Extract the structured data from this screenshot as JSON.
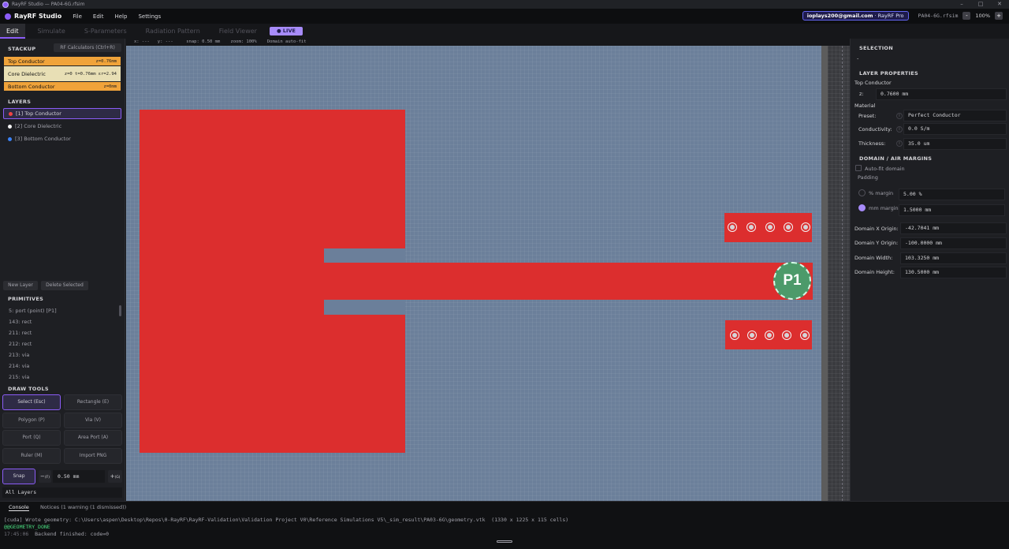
{
  "os": {
    "title": "RayRF Studio — PA04-6G.rfsim",
    "controls": [
      "–",
      "□",
      "✕"
    ]
  },
  "menubar": {
    "logo": "RayRF Studio",
    "menus": [
      "File",
      "Edit",
      "Help",
      "Settings"
    ],
    "account_email": "ioplays200@gmail.com",
    "account_plan": " · RayRF Pro",
    "file_name": "PA04-6G.rfsim",
    "zoom_out": "-",
    "zoom_value": "100%",
    "zoom_in": "+"
  },
  "tabs": [
    {
      "label": "Edit",
      "active": true
    },
    {
      "label": "Simulate",
      "active": false
    },
    {
      "label": "S-Parameters",
      "active": false
    },
    {
      "label": "Radiation Pattern",
      "active": false
    },
    {
      "label": "Field Viewer",
      "active": false
    }
  ],
  "live_badge": "● LIVE",
  "left": {
    "stackup_title": "STACKUP",
    "rf_calc_button": "RF Calculators (Ctrl+R)",
    "stack": [
      {
        "name": "Top Conductor",
        "meta": "z=0.76mm",
        "color": "#f0a33a"
      },
      {
        "name": "Core Dielectric",
        "meta": "z=0   t=0.76mm   εr=2.94",
        "color": "#e8dfb5"
      },
      {
        "name": "Bottom Conductor",
        "meta": "z=0mm",
        "color": "#f0a33a"
      }
    ],
    "layers_title": "LAYERS",
    "layers": [
      {
        "label": "[1] Top Conductor",
        "dot": "#ef4444",
        "selected": true
      },
      {
        "label": "[2] Core Dielectric",
        "dot": "#f4f4f5",
        "selected": false
      },
      {
        "label": "[3] Bottom Conductor",
        "dot": "#3b82f6",
        "selected": false
      }
    ],
    "new_layer": "New Layer",
    "delete_selected": "Delete Selected",
    "primitives_title": "PRIMITIVES",
    "primitives": [
      "5: port (point) [P1]",
      "143: rect",
      "211: rect",
      "212: rect",
      "213: via",
      "214: via",
      "215: via"
    ],
    "draw_tools_title": "DRAW TOOLS",
    "tools": [
      "Select (Esc)",
      "Rectangle (E)",
      "Polygon (P)",
      "Via (V)",
      "Port (Q)",
      "Area Port (A)",
      "Ruler (M)",
      "Import PNG"
    ],
    "snap_button": "Snap",
    "snap_minus": "−",
    "snap_minus_key": "(F)",
    "snap_value": "0.50 mm",
    "snap_plus": "+",
    "snap_plus_key": "(G)",
    "layer_filter": "All Layers"
  },
  "canvas": {
    "readout": "x: ---   y: ---     snap: 0.50 mm    zoom: 100%    Domain auto-fit",
    "port_label": "P1",
    "domain_color": "#6b7f9a",
    "conductor_color": "#dc2e2e"
  },
  "right": {
    "selection_title": "SELECTION",
    "selection_value": "-",
    "layer_props_title": "LAYER PROPERTIES",
    "layer_name": "Top Conductor",
    "z_label": "z:",
    "z_value": "0.7600 mm",
    "material_title": "Material",
    "preset_label": "Preset:",
    "preset_value": "Perfect Conductor",
    "conductivity_label": "Conductivity:",
    "conductivity_value": "0.0 S/m",
    "thickness_label": "Thickness:",
    "thickness_value": "35.0 um",
    "domain_title": "DOMAIN / AIR MARGINS",
    "autofit_label": "Auto-fit domain",
    "padding_label": "Padding",
    "pct_margin_label": "% margin",
    "pct_margin_value": "5.00 %",
    "mm_margin_label": "mm margin",
    "mm_margin_value": "1.5000 mm",
    "dom_x_label": "Domain X Origin:",
    "dom_x_value": "-42.7041 mm",
    "dom_y_label": "Domain Y Origin:",
    "dom_y_value": "-100.0000 mm",
    "dom_w_label": "Domain Width:",
    "dom_w_value": "103.3250 mm",
    "dom_h_label": "Domain Height:",
    "dom_h_value": "130.5000 mm"
  },
  "console": {
    "tab_console": "Console",
    "tab_notices": "Notices (1 warning (1 dismissed))",
    "line1": "[cuda] Wrote geometry: C:\\Users\\aspen\\Desktop\\Repos\\0-RayRF\\RayRF-Validation\\Validation Project V0\\Reference Simulations V5\\_sim_result\\PA03-6G\\geometry.vtk  (1330 x 1225 x 115 cells)",
    "line2": "@@GEOMETRY_DONE",
    "line3_time": "17:45:06",
    "line3_text": "  Backend finished: code=0"
  }
}
